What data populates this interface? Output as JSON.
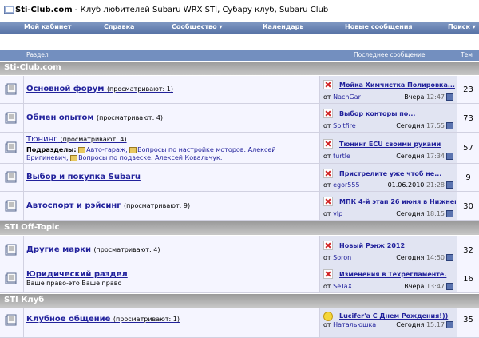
{
  "site": {
    "title_bold": "Sti-Club.com",
    "title_rest": " - Клуб любителей Subaru WRX STI, Субару клуб, Subaru Club"
  },
  "nav": {
    "items": [
      "Мой кабинет",
      "Справка",
      "Сообщество ▾",
      "Календарь",
      "Новые сообщения",
      "Поиск ▾"
    ]
  },
  "table_header": {
    "section": "Раздел",
    "last_post": "Последнее сообщение",
    "topics": "Тем"
  },
  "categories": [
    {
      "name": "Sti-Club.com"
    },
    {
      "name": "STI Off-Topic"
    },
    {
      "name": "STI Клуб"
    }
  ],
  "forums": [
    {
      "name": "Основной форум",
      "viewing": "(просматривают: 1)",
      "last_title": "Мойка Химчистка Полировка...",
      "last_by_prefix": "от",
      "last_by": "NachGar",
      "last_date": "Вчера",
      "last_time": "12:47",
      "topics": "23"
    },
    {
      "name": "Обмен опытом",
      "viewing": "(просматривают: 4)",
      "last_title": "Выбор конторы по...",
      "last_by_prefix": "от",
      "last_by": "Spitfire",
      "last_date": "Сегодня",
      "last_time": "17:55",
      "topics": "73"
    },
    {
      "name": "Тюнинг",
      "viewing": "(просматривают: 4)",
      "subforums_label": "Подразделы:",
      "subforums": [
        "Авто-гараж,",
        "Вопросы по настройке моторов. Алексей Бригиневич,",
        "Вопросы по подвеске. Алексей Ковальчук."
      ],
      "last_title": "Тюнинг ECU своими руками",
      "last_by_prefix": "от",
      "last_by": "turtle",
      "last_date": "Сегодня",
      "last_time": "17:34",
      "topics": "57"
    },
    {
      "name": "Выбор и покупка Subaru",
      "viewing": "",
      "last_title": "Пристрелите уже чтоб не...",
      "last_by_prefix": "от",
      "last_by": "egor555",
      "last_date": "01.06.2010",
      "last_time": "21:28",
      "topics": "9"
    },
    {
      "name": "Автоспорт и рэйсинг",
      "viewing": "(просматривают: 9)",
      "last_title": "МПК 4-й этап 26 июня в Нижнем...",
      "last_by_prefix": "от",
      "last_by": "vlp",
      "last_date": "Сегодня",
      "last_time": "18:15",
      "topics": "30"
    },
    {
      "name": "Другие марки",
      "viewing": "(просматривают: 4)",
      "last_title": "Новый Рэнж 2012",
      "last_by_prefix": "от",
      "last_by": "Soron",
      "last_date": "Сегодня",
      "last_time": "14:50",
      "topics": "32"
    },
    {
      "name": "Юридический раздел",
      "viewing": "",
      "description": "Ваше право-это Ваше право",
      "last_title": "Изменения в Техрегламенте.",
      "last_by_prefix": "от",
      "last_by": "SeTaX",
      "last_date": "Вчера",
      "last_time": "13:47",
      "topics": "16"
    },
    {
      "name": "Клубное общение",
      "viewing": "(просматривают: 1)",
      "last_title": "Lucifer'a С Днем Рождения!))",
      "last_by_prefix": "от",
      "last_by": "Натальюшка",
      "last_date": "Сегодня",
      "last_time": "15:17",
      "topics": "35"
    }
  ],
  "colors": {
    "navbar": "#6a84b6",
    "header": "#738fbf",
    "category": "#a8a8a8",
    "row_bg": "#f5f5ff",
    "last_bg": "#e1e4f2",
    "link": "#22229c"
  },
  "icons": [
    "home-icon",
    "folder-icon",
    "broken-image-icon",
    "smile-icon",
    "goto-last-icon",
    "subforum-folder-icon"
  ]
}
